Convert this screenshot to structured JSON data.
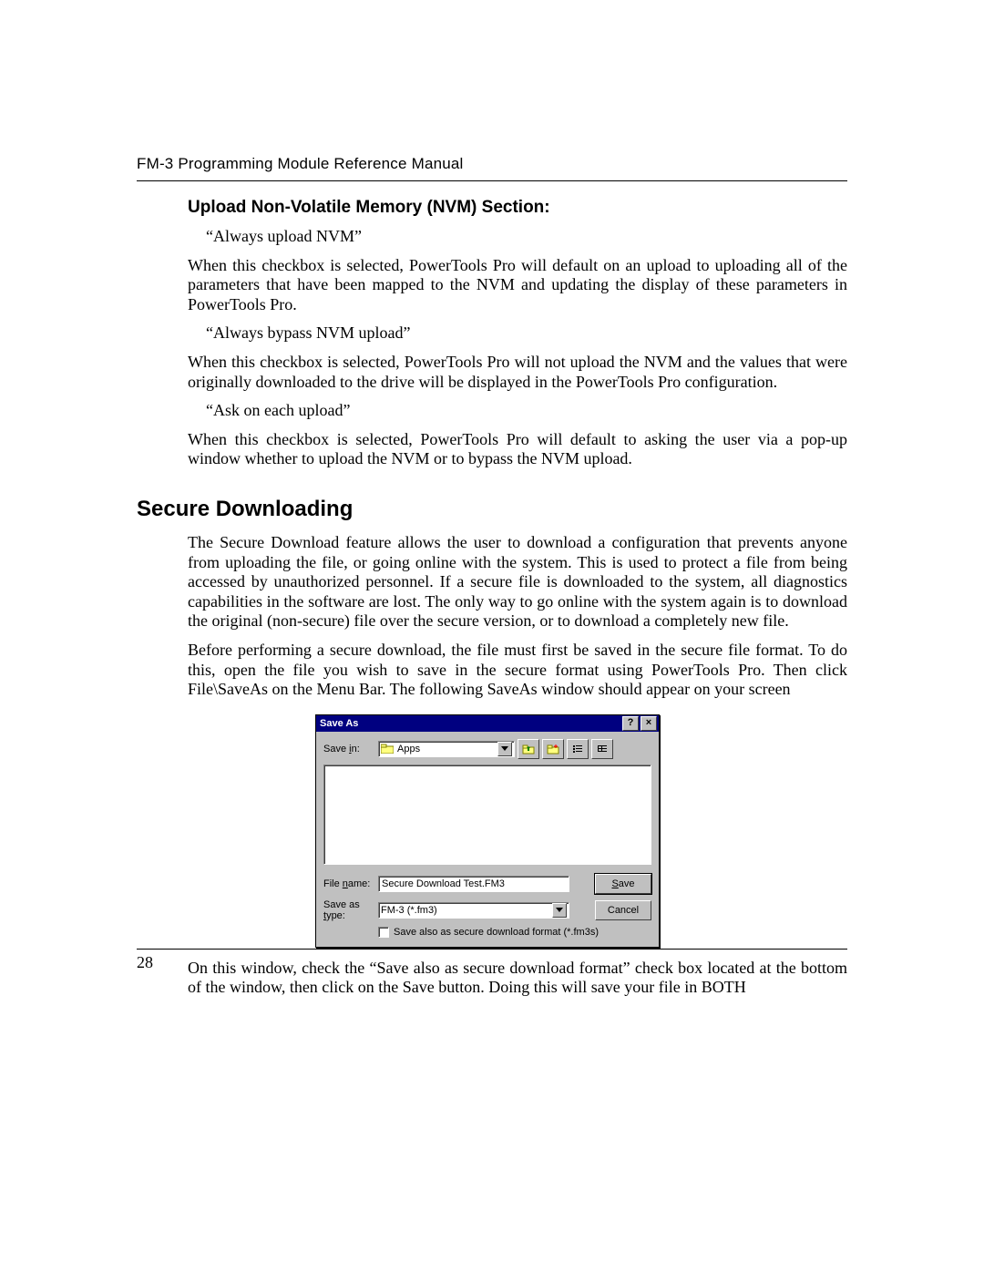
{
  "header": "FM-3 Programming Module Reference Manual",
  "section_title": "Upload Non-Volatile Memory (NVM) Section:",
  "opt1_label": "“Always upload NVM”",
  "opt1_desc": "When this checkbox is selected, PowerTools Pro will default on an upload to uploading all of the parameters that have been mapped to the NVM and updating the display of these parameters in PowerTools Pro.",
  "opt2_label": "“Always bypass NVM upload”",
  "opt2_desc": "When this checkbox is selected, PowerTools Pro will not upload the NVM and the values that were originally downloaded to the drive will be displayed in the PowerTools Pro configuration.",
  "opt3_label": "“Ask on each upload”",
  "opt3_desc": "When this checkbox is selected, PowerTools Pro will default to asking the user via a pop-up window whether to upload the NVM or to bypass the NVM upload.",
  "h2": "Secure Downloading",
  "p1": "The Secure Download feature allows the user to download a configuration that prevents anyone from uploading the file, or going online with the system.  This is used to protect a file from being accessed by unauthorized personnel.  If a secure file is downloaded to the system, all diagnostics capabilities in the software are lost.  The only way to go online with the system again is to download the original (non-secure) file over the secure version, or to download a completely new file.",
  "p2": "Before performing a secure download, the file must first be saved in the secure file format.  To do this, open the file you wish to save in the secure format using PowerTools Pro. Then click File\\SaveAs on the Menu Bar. The following SaveAs window should appear on your screen",
  "p3": "On this window, check the “Save also as secure download format” check box located at the bottom of the window, then click on the Save button.  Doing this will save your file in BOTH",
  "page_number": "28",
  "dialog": {
    "title": "Save As",
    "help_glyph": "?",
    "close_glyph": "×",
    "save_in_label": "Save in:",
    "save_in_value": "Apps",
    "file_name_label": "File name:",
    "file_name_value": "Secure Download Test.FM3",
    "save_as_type_label": "Save as type:",
    "save_as_type_value": "FM-3 (*.fm3)",
    "save_button": "Save",
    "cancel_button": "Cancel",
    "checkbox_label": "Save also as secure download format (*.fm3s)"
  }
}
